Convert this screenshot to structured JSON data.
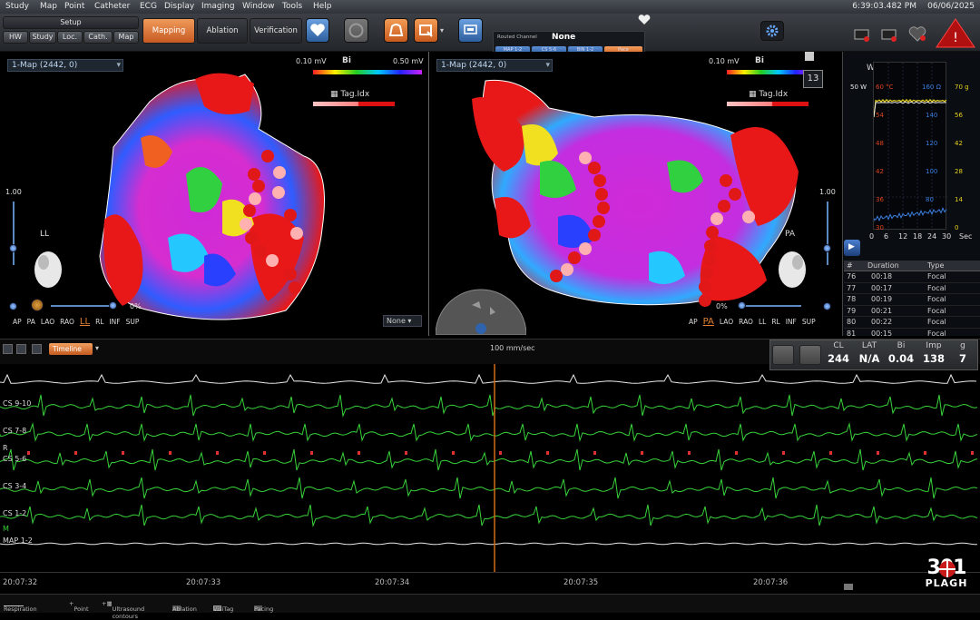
{
  "menu": [
    "Study",
    "Map",
    "Point",
    "Catheter",
    "ECG",
    "Display",
    "Imaging",
    "Window",
    "Tools",
    "Help"
  ],
  "status": {
    "time": "6:39:03.482 PM",
    "date": "06/06/2025"
  },
  "toolbar": {
    "setup_label": "Setup",
    "setup_tabs": [
      "HW",
      "Study",
      "Loc.",
      "Cath.",
      "Map"
    ],
    "modes": [
      "Mapping",
      "Ablation",
      "Verification"
    ],
    "routed_channel_label": "Routed Channel",
    "routed_channel_value": "None",
    "routed_chips": [
      "MAP 1-2",
      "CS 5-6",
      "BIN 1-2",
      "Pace"
    ]
  },
  "left_map": {
    "selector": "1-Map (2442, 0)",
    "scale_min": "0.10 mV",
    "scale_max": "0.50 mV",
    "scale_mode": "Bi",
    "tag_label": "Tag.Idx",
    "zoom_value": "1.00",
    "orientation_label": "LL",
    "opacity_label": "0%",
    "dropdown": "None",
    "views": [
      "AP",
      "PA",
      "LAO",
      "RAO",
      "LL",
      "RL",
      "INF",
      "SUP"
    ],
    "selected_view": "LL"
  },
  "right_map": {
    "selector": "1-Map (2442, 0)",
    "scale_min": "0.10 mV",
    "scale_mode": "Bi",
    "tag_label": "Tag.Idx",
    "zoom_value": "1.00",
    "orientation_label": "PA",
    "opacity_label": "0%",
    "badge": "13",
    "views": [
      "AP",
      "PA",
      "LAO",
      "RAO",
      "LL",
      "RL",
      "INF",
      "SUP"
    ],
    "selected_view": "PA"
  },
  "ablation_graph": {
    "header_symbols": [
      "W",
      "°C",
      "Ω",
      "g"
    ],
    "power_label": "50 W",
    "temp_label": "60 °C",
    "imp_label": "160 Ω",
    "force_label": "70 g",
    "temp_ticks": [
      "54",
      "48",
      "42",
      "36",
      "30"
    ],
    "imp_ticks": [
      "140",
      "120",
      "100",
      "80"
    ],
    "force_ticks": [
      "56",
      "42",
      "28",
      "14",
      "0"
    ],
    "x_ticks": [
      "0",
      "6",
      "12",
      "18",
      "24",
      "30"
    ],
    "x_unit": "Sec",
    "colors": {
      "power": "#e8e8e8",
      "temp": "#e0431e",
      "imp": "#3a7fe0",
      "force": "#e8d21e"
    }
  },
  "lesion_table": {
    "headers": [
      "#",
      "Duration",
      "Type"
    ],
    "rows": [
      {
        "n": "76",
        "d": "00:18",
        "t": "Focal"
      },
      {
        "n": "77",
        "d": "00:17",
        "t": "Focal"
      },
      {
        "n": "78",
        "d": "00:19",
        "t": "Focal"
      },
      {
        "n": "79",
        "d": "00:21",
        "t": "Focal"
      },
      {
        "n": "80",
        "d": "00:22",
        "t": "Focal"
      },
      {
        "n": "81",
        "d": "00:15",
        "t": "Focal"
      }
    ]
  },
  "ecg": {
    "timeline_label": "Timeline",
    "speed": "100 mm/sec",
    "metrics": [
      {
        "label": "CL",
        "value": "244"
      },
      {
        "label": "LAT",
        "value": "N/A"
      },
      {
        "label": "Bi",
        "value": "0.04"
      },
      {
        "label": "Imp",
        "value": "138"
      },
      {
        "label": "g",
        "value": "7"
      }
    ],
    "channels": [
      "CS 9-10",
      "CS 7-8",
      "CS 5-6",
      "CS 3-4",
      "CS 1-2",
      "MAP 1-2"
    ],
    "channel_prefixes": [
      "R",
      "M"
    ],
    "times": [
      "20:07:32",
      "20:07:33",
      "20:07:34",
      "20:07:35",
      "20:07:36"
    ],
    "colors": {
      "surface": "#e8e8e8",
      "cs": "#38d23a",
      "cursor": "#d06a18"
    }
  },
  "legend": [
    "Respiration",
    "Point",
    "Ultrasound contours",
    "Ablation",
    "VisiTag",
    "Pacing"
  ],
  "watermark": {
    "number": "301",
    "text": "PLAGH"
  }
}
